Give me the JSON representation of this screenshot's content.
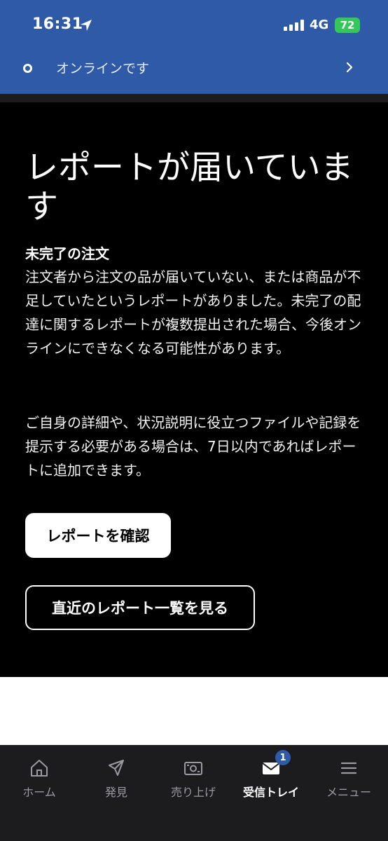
{
  "status_bar": {
    "time": "16:31",
    "network": "4G",
    "battery": "72"
  },
  "online_banner": {
    "text": "オンラインです"
  },
  "report_card": {
    "title": "レポートが届いています",
    "subheading": "未完了の注文",
    "paragraph1": "注文者から注文の品が届いていない、または商品が不足していたというレポートがありました。未完了の配達に関するレポートが複数提出された場合、今後オンラインにできなくなる可能性があります。",
    "paragraph2": "ご自身の詳細や、状況説明に役立つファイルや記録を提示する必要がある場合は、7日以内であればレポートに追加できます。",
    "primary_button": "レポートを確認",
    "secondary_button": "直近のレポート一覧を見る"
  },
  "tab_bar": {
    "tabs": [
      {
        "label": "ホーム",
        "icon": "home-icon"
      },
      {
        "label": "発見",
        "icon": "compass-icon"
      },
      {
        "label": "売り上げ",
        "icon": "banknote-icon"
      },
      {
        "label": "受信トレイ",
        "icon": "mail-icon",
        "badge": "1",
        "active": true
      },
      {
        "label": "メニュー",
        "icon": "menu-icon"
      }
    ]
  },
  "colors": {
    "header_blue": "#2f5aa8",
    "battery_green": "#34c759",
    "card_bg": "#000000",
    "tabbar_bg": "#1c1c1e"
  }
}
